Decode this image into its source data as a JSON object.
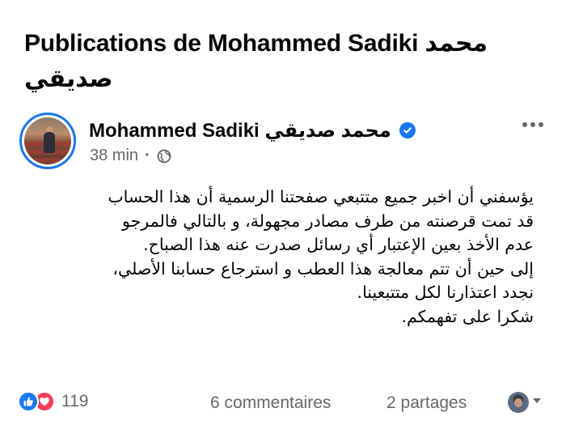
{
  "page": {
    "title": "Publications de Mohammed Sadiki محمد صديقي"
  },
  "post": {
    "author": "Mohammed Sadiki محمد صديقي",
    "verified": true,
    "time": "38 min",
    "audience_icon": "globe-icon",
    "more_icon": "more-options-icon",
    "body_lines": [
      "يؤسفني أن اخبر جميع متتبعي صفحتنا الرسمية أن هذا الحساب",
      "قد  تمت قرصنته من طرف مصادر مجهولة، و بالتالي فالمرجو",
      "عدم الأخذ بعين الإعتبار  أي رسائل صدرت عنه هذا الصباح.",
      "إلى حين أن تتم معالجة هذا العطب و استرجاع حسابنا الأصلي،",
      "نجدد اعتذارنا لكل متتبعينا.",
      "شكرا على تفهمكم."
    ]
  },
  "footer": {
    "reaction_icons": [
      "like-icon",
      "love-icon"
    ],
    "reaction_count": "119",
    "comments": "6 commentaires",
    "shares": "2 partages"
  },
  "colors": {
    "accent": "#1877f2",
    "love": "#f33e58",
    "secondary_text": "#65676b"
  }
}
